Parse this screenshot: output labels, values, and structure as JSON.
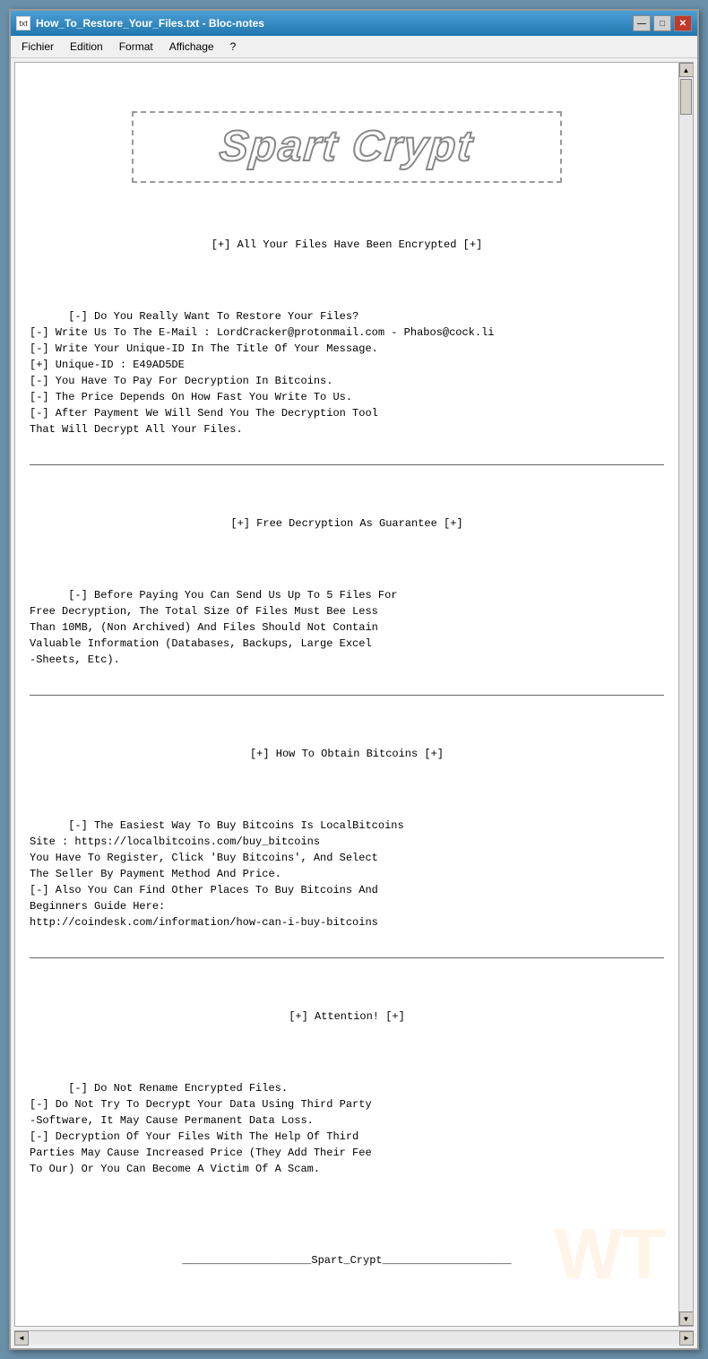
{
  "window": {
    "title": "How_To_Restore_Your_Files.txt - Bloc-notes",
    "icon_label": "txt"
  },
  "titlebar": {
    "minimize_label": "—",
    "maximize_label": "□",
    "close_label": "✕"
  },
  "menubar": {
    "items": [
      {
        "label": "Fichier"
      },
      {
        "label": "Edition"
      },
      {
        "label": "Format"
      },
      {
        "label": "Affichage"
      },
      {
        "label": "?"
      }
    ]
  },
  "logo": {
    "text": "Spart Crypt"
  },
  "content": {
    "header": "[+] All Your Files Have Been Encrypted [+]",
    "section1": "[-] Do You Really Want To Restore Your Files?\n[-] Write Us To The E-Mail : LordCracker@protonmail.com - Phabos@cock.li\n[-] Write Your Unique-ID In The Title Of Your Message.\n[+] Unique-ID : E49AD5DE\n[-] You Have To Pay For Decryption In Bitcoins.\n[-] The Price Depends On How Fast You Write To Us.\n[-] After Payment We Will Send You The Decryption Tool\nThat Will Decrypt All Your Files.",
    "section2_header": "[+] Free Decryption As Guarantee [+]",
    "section2": "[-] Before Paying You Can Send Us Up To 5 Files For\nFree Decryption, The Total Size Of Files Must Bee Less\nThan 10MB, (Non Archived) And Files Should Not Contain\nValuable Information (Databases, Backups, Large Excel\n-Sheets, Etc).",
    "section3_header": "[+] How To Obtain Bitcoins [+]",
    "section3": "[-] The Easiest Way To Buy Bitcoins Is LocalBitcoins\nSite : https://localbitcoins.com/buy_bitcoins\nYou Have To Register, Click 'Buy Bitcoins', And Select\nThe Seller By Payment Method And Price.\n[-] Also You Can Find Other Places To Buy Bitcoins And\nBeginners Guide Here:\nhttp://coindesk.com/information/how-can-i-buy-bitcoins",
    "section4_header": "[+] Attention! [+]",
    "section4": "[-] Do Not Rename Encrypted Files.\n[-] Do Not Try To Decrypt Your Data Using Third Party\n-Software, It May Cause Permanent Data Loss.\n[-] Decryption Of Your Files With The Help Of Third\nParties May Cause Increased Price (They Add Their Fee\nTo Our) Or You Can Become A Victim Of A Scam.",
    "signature": "____________________Spart_Crypt____________________"
  },
  "scrollbar": {
    "up_arrow": "▲",
    "down_arrow": "▼",
    "left_arrow": "◄",
    "right_arrow": "►"
  }
}
